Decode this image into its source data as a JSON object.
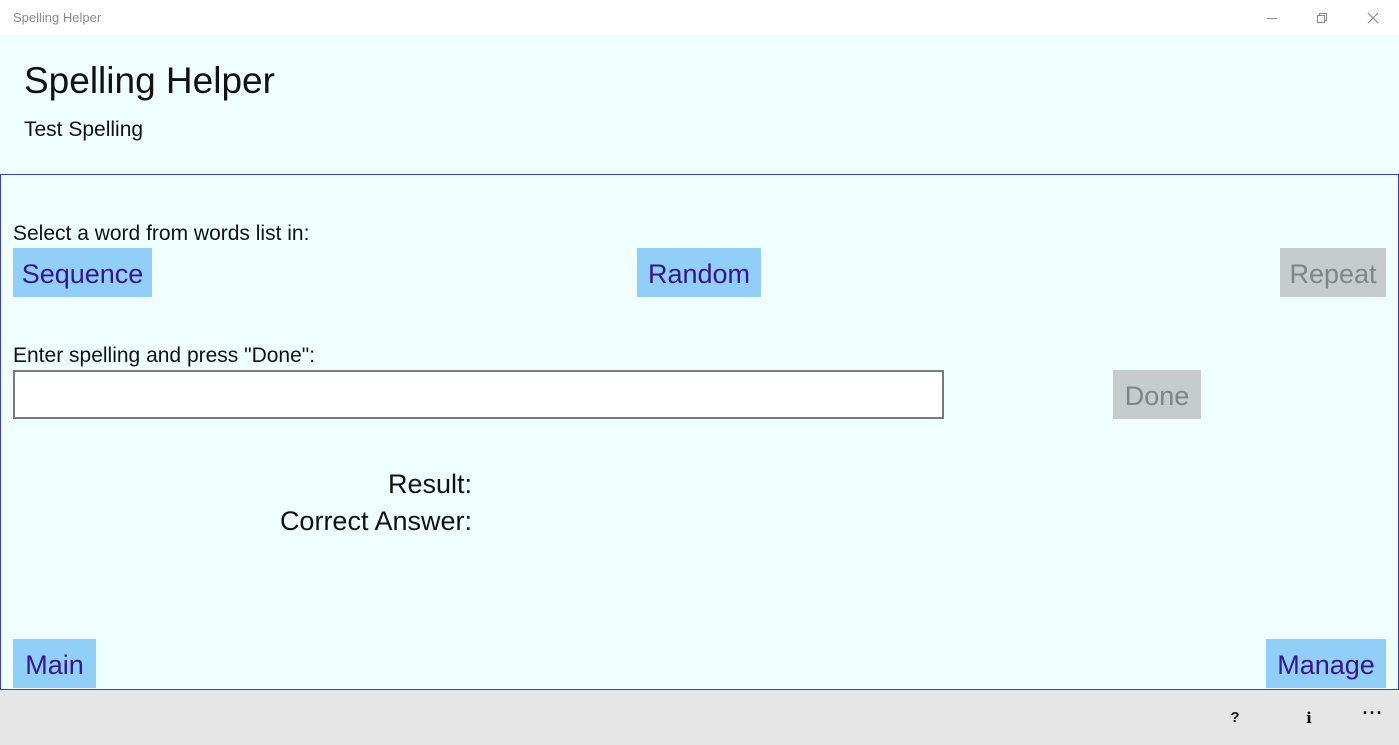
{
  "window": {
    "title": "Spelling Helper"
  },
  "header": {
    "title": "Spelling Helper",
    "subtitle": "Test Spelling"
  },
  "select_section": {
    "label": "Select a word from words list in:",
    "sequence_label": "Sequence",
    "random_label": "Random",
    "repeat_label": "Repeat"
  },
  "entry_section": {
    "label": "Enter spelling and press \"Done\":",
    "input_value": "",
    "done_label": "Done"
  },
  "results": {
    "result_label": "Result:",
    "correct_answer_label": "Correct Answer:"
  },
  "navigation": {
    "main_label": "Main",
    "manage_label": "Manage"
  },
  "appbar": {
    "help_glyph": "?",
    "info_glyph": "i",
    "more_glyph": "···"
  },
  "colors": {
    "background": "#efffff",
    "button": "#8fcff8",
    "button_text": "#3a138f",
    "button_disabled": "#c5cccc",
    "button_disabled_text": "#7d8585",
    "panel_border": "#3b3bd6",
    "appbar": "#e6e6e6"
  }
}
